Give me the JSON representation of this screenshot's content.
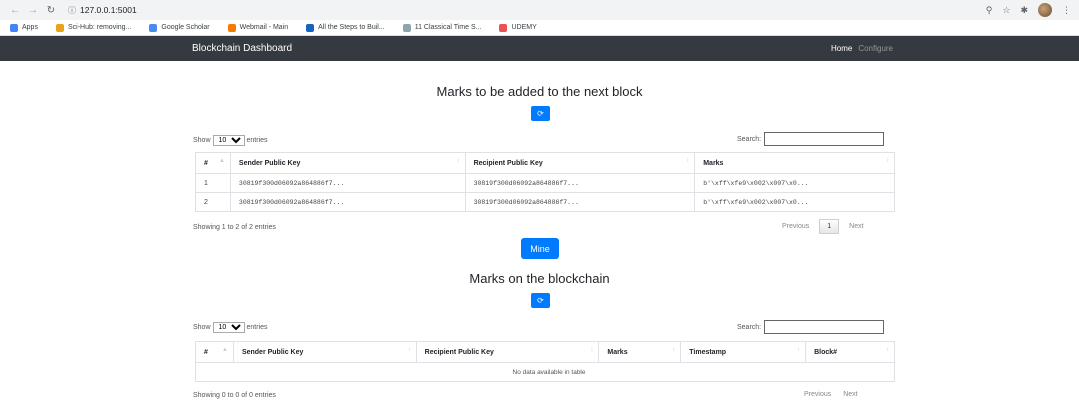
{
  "browser": {
    "url": "127.0.0.1:5001",
    "bookmarks": [
      "Apps",
      "Sci-Hub: removing...",
      "Google Scholar",
      "Webmail - Main",
      "All the Steps to Buil...",
      "11 Classical Time S...",
      "UDEMY"
    ]
  },
  "navbar": {
    "brand": "Blockchain Dashboard",
    "home": "Home",
    "configure": "Configure"
  },
  "pending": {
    "title": "Marks to be added to the next block",
    "show_label": "Show",
    "entries_value": "10",
    "entries_label": "entries",
    "search_label": "Search:",
    "columns": [
      "#",
      "Sender Public Key",
      "Recipient Public Key",
      "Marks"
    ],
    "rows": [
      [
        "1",
        "30819f300d06092a864886f7...",
        "30819f300d06092a864886f7...",
        "b'\\xff\\xfe9\\x002\\x007\\x0..."
      ],
      [
        "2",
        "30819f300d06092a864886f7...",
        "30819f300d06092a864886f7...",
        "b'\\xff\\xfe9\\x002\\x007\\x0..."
      ]
    ],
    "info": "Showing 1 to 2 of 2 entries",
    "previous": "Previous",
    "page": "1",
    "next": "Next"
  },
  "mine_label": "Mine",
  "chain": {
    "title": "Marks on the blockchain",
    "show_label": "Show",
    "entries_value": "10",
    "entries_label": "entries",
    "search_label": "Search:",
    "columns": [
      "#",
      "Sender Public Key",
      "Recipient Public Key",
      "Marks",
      "Timestamp",
      "Block#"
    ],
    "empty": "No data available in table",
    "info": "Showing 0 to 0 of 0 entries",
    "previous": "Previous",
    "next": "Next"
  },
  "colors": {
    "navbar": "#343a40",
    "primary": "#007bff"
  }
}
